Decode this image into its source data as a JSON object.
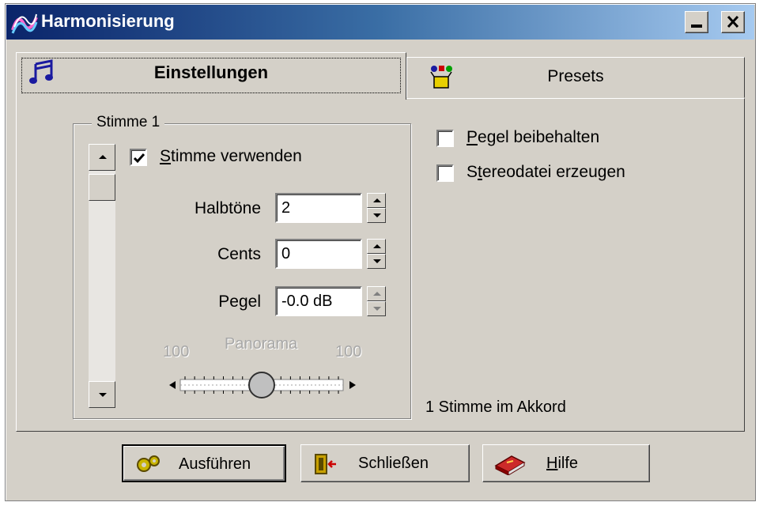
{
  "window": {
    "title": "Harmonisierung"
  },
  "tabs": [
    {
      "label": "Einstellungen",
      "icon": "music-notes-icon"
    },
    {
      "label": "Presets",
      "icon": "presets-box-icon"
    }
  ],
  "voice_group": {
    "title": "Stimme 1",
    "use_voice": {
      "accel": "S",
      "rest": "timme verwenden",
      "checked": true
    },
    "semitones": {
      "label": "Halbtöne",
      "value": "2"
    },
    "cents": {
      "label": "Cents",
      "value": "0"
    },
    "level": {
      "label": "Pegel",
      "value": "-0.0 dB"
    },
    "panorama": {
      "label": "Panorama",
      "left": "100",
      "right": "100",
      "position": 0.5
    }
  },
  "options": {
    "keep_level": {
      "accel": "P",
      "rest": "egel beibehalten",
      "checked": false
    },
    "stereo_file": {
      "pre": "S",
      "accel": "t",
      "rest": "ereodatei erzeugen",
      "checked": false
    }
  },
  "status": "1 Stimme im Akkord",
  "buttons": {
    "execute": {
      "label": "Ausführen"
    },
    "close": {
      "label": "Schließen"
    },
    "help": {
      "accel": "H",
      "rest": "ilfe"
    }
  }
}
